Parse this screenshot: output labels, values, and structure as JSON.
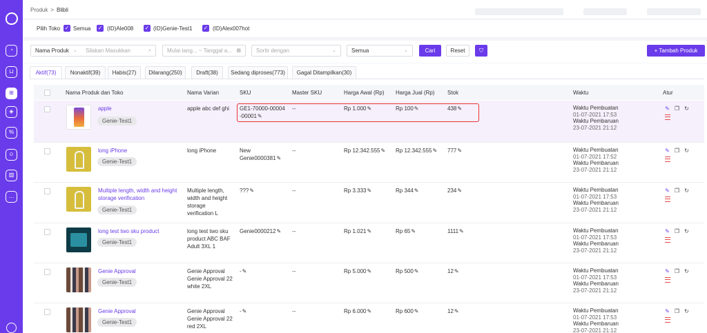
{
  "breadcrumb": {
    "parent": "Produk",
    "separator": ">",
    "current": "Blibli"
  },
  "store_filter": {
    "label": "Pilih Toko",
    "options": [
      {
        "label": "Semua",
        "checked": true
      },
      {
        "label": "(ID)Ale008",
        "checked": true
      },
      {
        "label": "(ID)Genie-Test1",
        "checked": true
      },
      {
        "label": "(ID)Alex007hot",
        "checked": true
      }
    ]
  },
  "filters": {
    "field_select": "Nama Produk",
    "search_placeholder": "Silakan Masukkan",
    "date_start_placeholder": "Mulai tang...",
    "date_sep": "~",
    "date_end_placeholder": "Tanggal a...",
    "sort_placeholder": "Sortir dengan",
    "status_select": "Semua",
    "search_button": "Cari",
    "reset_button": "Reset",
    "add_button": "Tambah Produk"
  },
  "tabs": [
    "Aktif(73)",
    "Nonaktif(39)",
    "Habis(27)",
    "Dilarang(250)",
    "Draft(38)",
    "Sedang diproses(773)",
    "Gagal Ditampilkan(30)"
  ],
  "columns": {
    "product": "Nama Produk dan Toko",
    "variant": "Nama Varian",
    "sku": "SKU",
    "master_sku": "Master SKU",
    "price_start": "Harga Awal (Rp)",
    "price_sell": "Harga Jual (Rp)",
    "stock": "Stok",
    "time": "Waktu",
    "actions": "Atur"
  },
  "labels": {
    "created": "Waktu Pembuatan",
    "updated": "Waktu Pembaruan",
    "pen": "✎"
  },
  "rows": [
    {
      "name": "apple",
      "store": "Genie-Test1",
      "variant": "apple abc def ghi",
      "sku": "GE1-70000-00004-00001",
      "master_sku": "--",
      "price_start": "Rp 1.000",
      "price_sell": "Rp 100",
      "stock": "438",
      "created": "01-07-2021 17:53",
      "updated": "23-07-2021 21:12"
    },
    {
      "name": "long iPhone",
      "store": "Genie-Test1",
      "variant": "long iPhone",
      "sku": "New Genie0000381",
      "master_sku": "--",
      "price_start": "Rp 12.342.555",
      "price_sell": "Rp 12.342.555",
      "stock": "777",
      "created": "01-07-2021 17:52",
      "updated": "23-07-2021 21:12"
    },
    {
      "name": "Multiple length, width and height storage verification",
      "store": "Genie-Test1",
      "variant": "Multiple length, width and height storage verification L",
      "sku": "???",
      "master_sku": "--",
      "price_start": "Rp 3.333",
      "price_sell": "Rp 344",
      "stock": "234",
      "created": "01-07-2021 17:53",
      "updated": "23-07-2021 21:12"
    },
    {
      "name": "long test two sku product",
      "store": "Genie-Test1",
      "variant": "long test two sku product ABC BAF Adult 3XL 1",
      "sku": "Genie0000212",
      "master_sku": "--",
      "price_start": "Rp 1.021",
      "price_sell": "Rp 65",
      "stock": "1111",
      "created": "01-07-2021 17:53",
      "updated": "23-07-2021 21:12"
    },
    {
      "name": "Genie Approval",
      "store": "Genie-Test1",
      "variant": "Genie Approval Genie Approval 22 white 2XL",
      "sku": "-",
      "master_sku": "--",
      "price_start": "Rp 5.000",
      "price_sell": "Rp 500",
      "stock": "12",
      "created": "01-07-2021 17:53",
      "updated": "23-07-2021 21:12"
    },
    {
      "name": "Genie Approval",
      "store": "Genie-Test1",
      "variant": "Genie Approval Genie Approval 22 red 2XL",
      "sku": "-",
      "master_sku": "--",
      "price_start": "Rp 6.000",
      "price_sell": "Rp 600",
      "stock": "12",
      "created": "01-07-2021 17:53",
      "updated": "23-07-2021 21:12"
    }
  ],
  "colors": {
    "accent": "#6a3bea",
    "highlight_box": "#e53333",
    "delete": "#e44a4a"
  }
}
